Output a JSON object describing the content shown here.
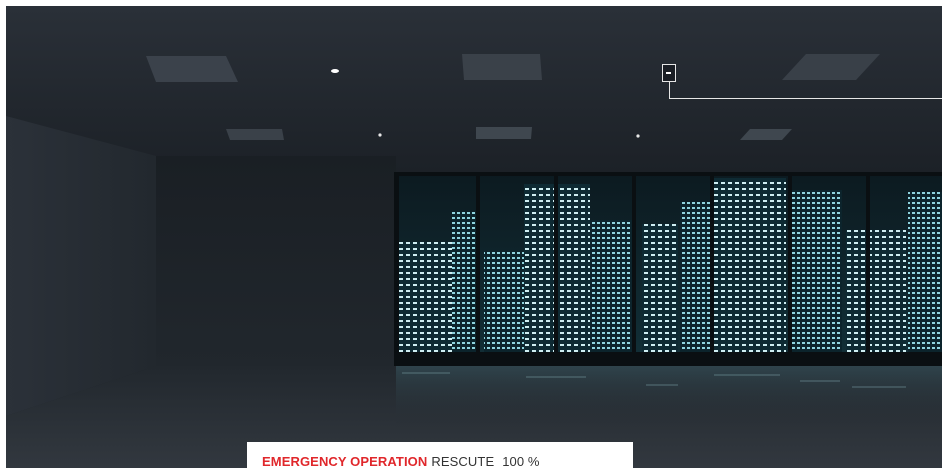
{
  "caption": {
    "highlight": "EMERGENCY OPERATION",
    "label": "RESCUTE",
    "value": "100 %"
  },
  "colors": {
    "highlight": "#e0272b",
    "caption_text": "#333333",
    "caption_bg": "#ffffff",
    "callout_line": "#e6e6e6"
  },
  "icons": {
    "callout": "emergency-light-marker-icon"
  }
}
